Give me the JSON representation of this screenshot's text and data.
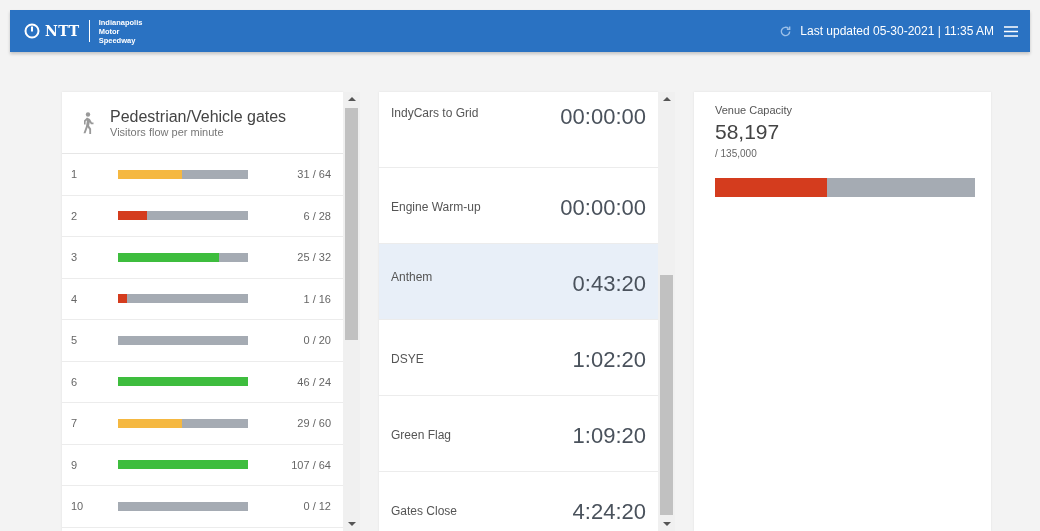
{
  "header": {
    "logo_text": "NTT",
    "venue_lines": [
      "Indianapolis",
      "Motor",
      "Speedway"
    ],
    "last_updated": "Last updated 05-30-2021 | 11:35 AM"
  },
  "gates": {
    "title": "Pedestrian/Vehicle gates",
    "subtitle": "Visitors flow per minute",
    "rows": [
      {
        "gate": "1",
        "level": 0.49,
        "color": "#f5b841",
        "reading": "31 / 64"
      },
      {
        "gate": "2",
        "level": 0.22,
        "color": "#d43c1e",
        "reading": "6 / 28"
      },
      {
        "gate": "3",
        "level": 0.78,
        "color": "#3ebd3e",
        "reading": "25 / 32"
      },
      {
        "gate": "4",
        "level": 0.07,
        "color": "#d43c1e",
        "reading": "1 / 16"
      },
      {
        "gate": "5",
        "reading": "0 / 20"
      },
      {
        "gate": "6",
        "level": 1,
        "color": "#3ebd3e",
        "reading": "46 / 24"
      },
      {
        "gate": "7",
        "level": 0.49,
        "color": "#f5b841",
        "reading": "29 / 60"
      },
      {
        "gate": "9",
        "level": 1,
        "color": "#3ebd3e",
        "reading": "107 / 64"
      },
      {
        "gate": "10",
        "reading": "0 / 12"
      }
    ]
  },
  "schedule": [
    {
      "event": "IndyCars to Grid",
      "time": "00:00:00",
      "selected": false
    },
    {
      "event": "Engine Warm-up",
      "time": "00:00:00",
      "selected": false
    },
    {
      "event": "Anthem",
      "time": "0:43:20",
      "selected": true
    },
    {
      "event": "DSYE",
      "time": "1:02:20",
      "selected": false
    },
    {
      "event": "Green Flag",
      "time": "1:09:20",
      "selected": false
    },
    {
      "event": "Gates Close",
      "time": "4:24:20",
      "selected": false
    }
  ],
  "capacity": {
    "label": "Venue Capacity",
    "value": "58,197",
    "total": "/ 135,000",
    "level": 0.43
  }
}
